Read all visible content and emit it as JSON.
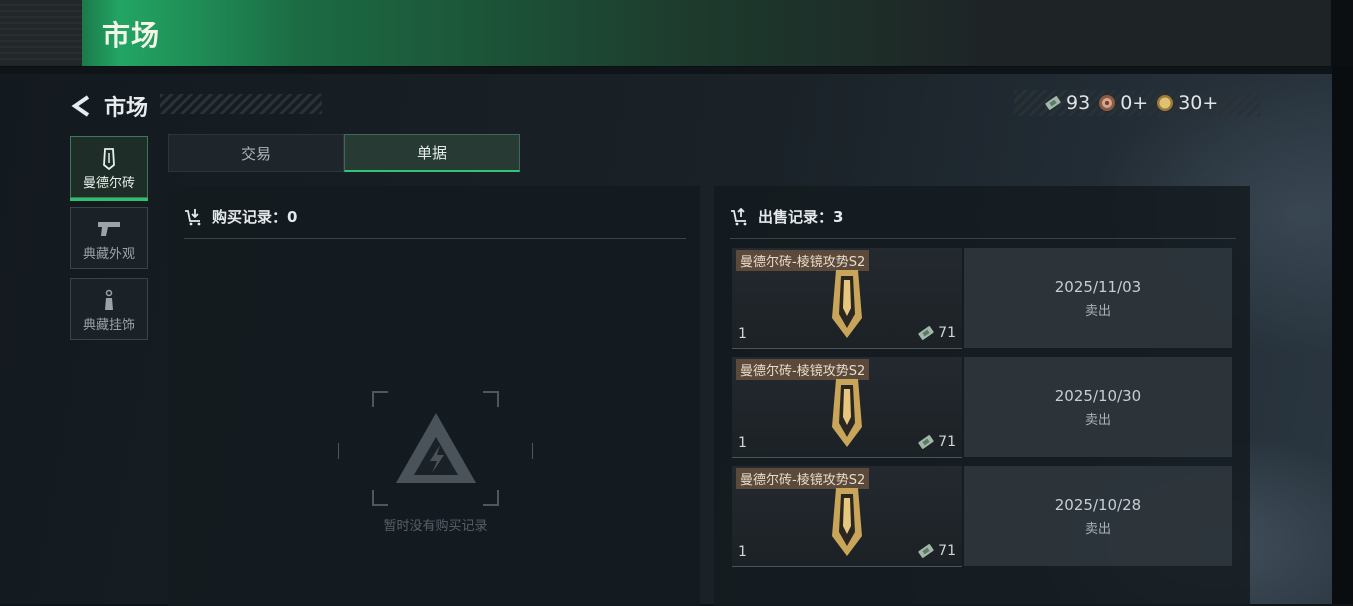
{
  "window": {
    "title": "市场"
  },
  "header": {
    "back_label": "市场"
  },
  "currency": [
    {
      "icon": "ticket-icon",
      "value": "93"
    },
    {
      "icon": "medal-icon",
      "value": "0+"
    },
    {
      "icon": "coin-icon",
      "value": "30+"
    }
  ],
  "categories": [
    {
      "label": "曼德尔砖",
      "icon": "brick-icon",
      "active": true
    },
    {
      "label": "典藏外观",
      "icon": "pistol-icon",
      "active": false
    },
    {
      "label": "典藏挂饰",
      "icon": "charm-icon",
      "active": false
    }
  ],
  "tabs": [
    {
      "label": "交易",
      "active": false
    },
    {
      "label": "单据",
      "active": true
    }
  ],
  "buy_records": {
    "title": "购买记录：0",
    "empty_text": "暂时没有购买记录"
  },
  "sell_records": {
    "title": "出售记录：3",
    "items": [
      {
        "name": "曼德尔砖-棱镜攻势S2",
        "qty": "1",
        "price": "71",
        "date": "2025/11/03",
        "status": "卖出"
      },
      {
        "name": "曼德尔砖-棱镜攻势S2",
        "qty": "1",
        "price": "71",
        "date": "2025/10/30",
        "status": "卖出"
      },
      {
        "name": "曼德尔砖-棱镜攻势S2",
        "qty": "1",
        "price": "71",
        "date": "2025/10/28",
        "status": "卖出"
      }
    ]
  },
  "colors": {
    "accent": "#2fbf6f",
    "tag_bg": "#5b4a3c"
  }
}
